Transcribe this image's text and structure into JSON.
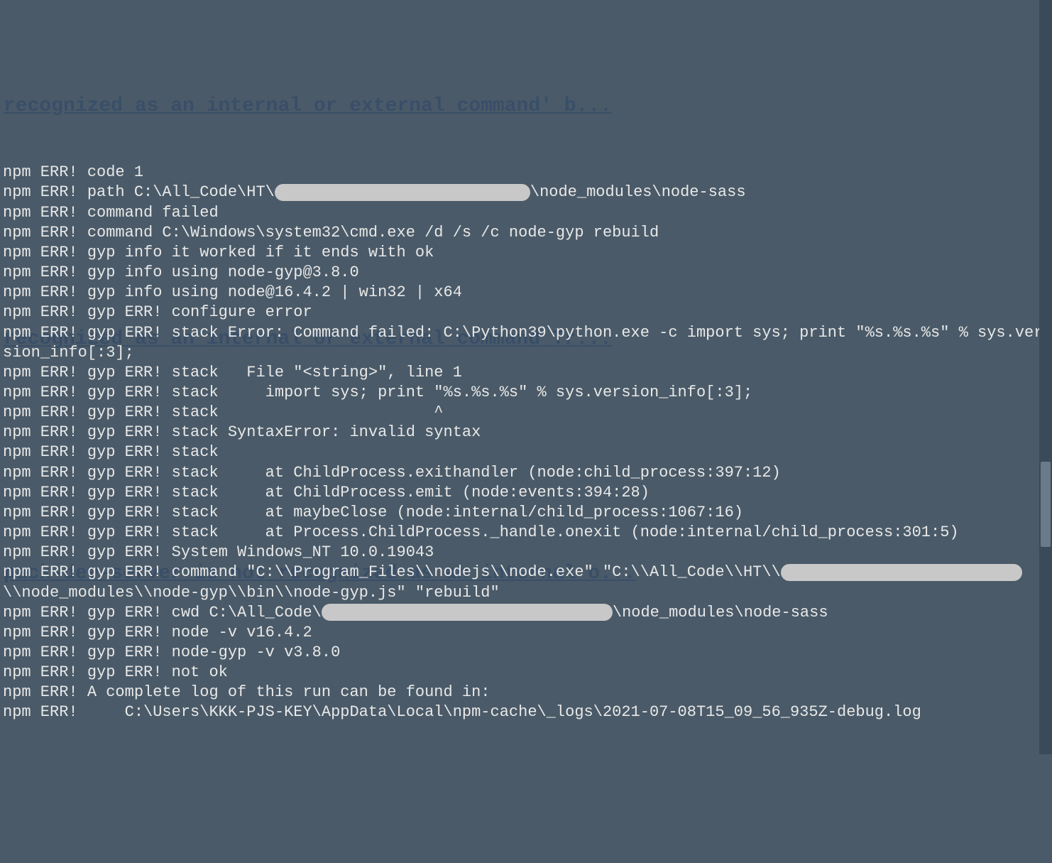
{
  "bg_links": {
    "link1": "recognized as an internal or external command' b...",
    "link2": "recognized as an internal or external command Tr...",
    "link3": "pack-dev-server is not recognized as an internal o..."
  },
  "terminal": {
    "lines": [
      {
        "text": "npm ERR! code 1"
      },
      {
        "parts": [
          {
            "text": "npm ERR! path C:\\All_Code\\HT\\"
          },
          {
            "redact": "redaction-1"
          },
          {
            "text": "\\node_modules\\node-sass"
          }
        ]
      },
      {
        "text": "npm ERR! command failed"
      },
      {
        "text": "npm ERR! command C:\\Windows\\system32\\cmd.exe /d /s /c node-gyp rebuild"
      },
      {
        "text": "npm ERR! gyp info it worked if it ends with ok"
      },
      {
        "text": "npm ERR! gyp info using node-gyp@3.8.0"
      },
      {
        "text": "npm ERR! gyp info using node@16.4.2 | win32 | x64"
      },
      {
        "text": "npm ERR! gyp ERR! configure error"
      },
      {
        "text": "npm ERR! gyp ERR! stack Error: Command failed: C:\\Python39\\python.exe -c import sys; print \"%s.%s.%s\" % sys.version_info[:3];"
      },
      {
        "text": "npm ERR! gyp ERR! stack   File \"<string>\", line 1"
      },
      {
        "text": "npm ERR! gyp ERR! stack     import sys; print \"%s.%s.%s\" % sys.version_info[:3];"
      },
      {
        "text": "npm ERR! gyp ERR! stack                       ^"
      },
      {
        "text": "npm ERR! gyp ERR! stack SyntaxError: invalid syntax"
      },
      {
        "text": "npm ERR! gyp ERR! stack"
      },
      {
        "text": "npm ERR! gyp ERR! stack     at ChildProcess.exithandler (node:child_process:397:12)"
      },
      {
        "text": "npm ERR! gyp ERR! stack     at ChildProcess.emit (node:events:394:28)"
      },
      {
        "text": "npm ERR! gyp ERR! stack     at maybeClose (node:internal/child_process:1067:16)"
      },
      {
        "text": "npm ERR! gyp ERR! stack     at Process.ChildProcess._handle.onexit (node:internal/child_process:301:5)"
      },
      {
        "text": "npm ERR! gyp ERR! System Windows_NT 10.0.19043"
      },
      {
        "parts": [
          {
            "text": "npm ERR! gyp ERR! command \"C:\\\\Program_Files\\\\nodejs\\\\node.exe\" \"C:\\\\All_Code\\\\HT\\\\"
          },
          {
            "redact": "redaction-2"
          },
          {
            "text": "\\\\node_modules\\\\node-gyp\\\\bin\\\\node-gyp.js\" \"rebuild\""
          }
        ]
      },
      {
        "parts": [
          {
            "text": "npm ERR! gyp ERR! cwd C:\\All_Code\\"
          },
          {
            "redact": "redaction-3"
          },
          {
            "text": "\\node_modules\\node-sass"
          }
        ]
      },
      {
        "text": "npm ERR! gyp ERR! node -v v16.4.2"
      },
      {
        "text": "npm ERR! gyp ERR! node-gyp -v v3.8.0"
      },
      {
        "text": "npm ERR! gyp ERR! not ok"
      },
      {
        "text": ""
      },
      {
        "text": "npm ERR! A complete log of this run can be found in:"
      },
      {
        "text": "npm ERR!     C:\\Users\\KKK-PJS-KEY\\AppData\\Local\\npm-cache\\_logs\\2021-07-08T15_09_56_935Z-debug.log"
      }
    ]
  }
}
